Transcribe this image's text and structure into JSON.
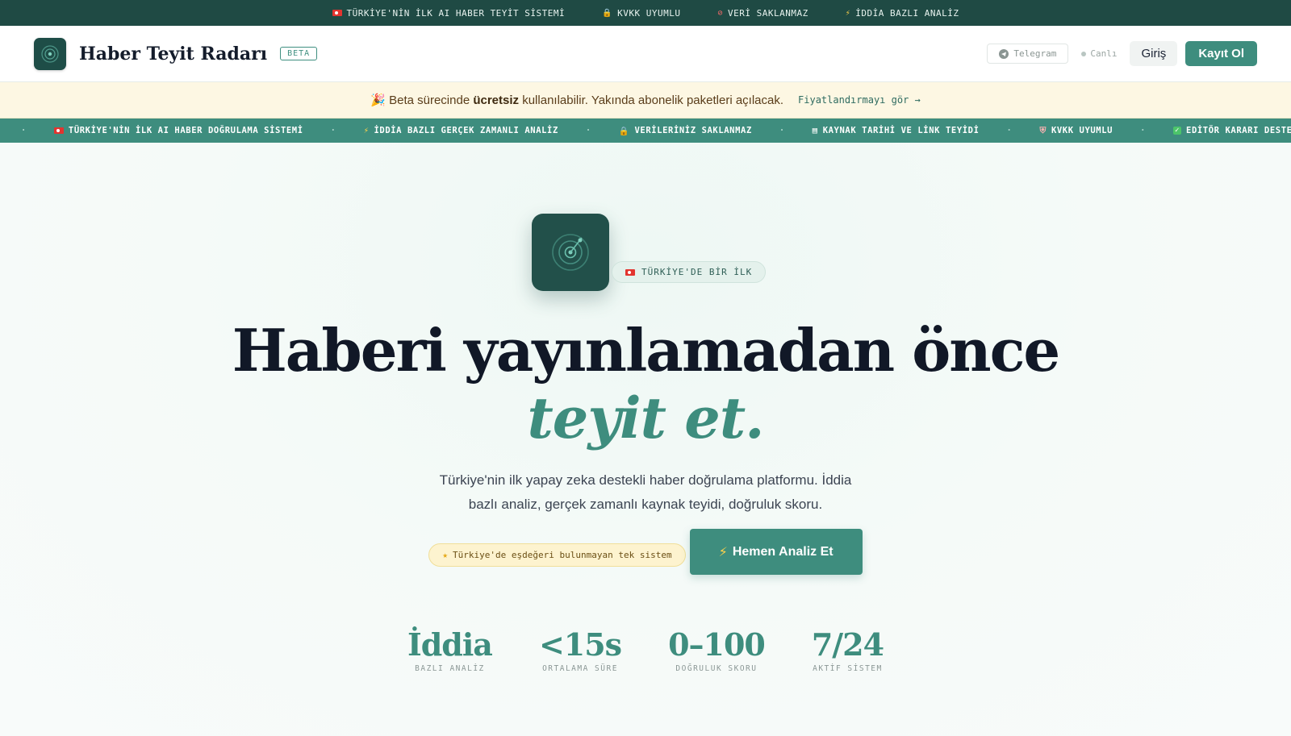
{
  "topstrip": {
    "items": [
      {
        "icon": "flag-icon",
        "label": "TÜRKİYE'NİN İLK AI HABER TEYİT SİSTEMİ"
      },
      {
        "icon": "lock-icon",
        "label": "KVKK UYUMLU"
      },
      {
        "icon": "no-entry-icon",
        "label": "VERİ SAKLANMAZ"
      },
      {
        "icon": "lightning-icon",
        "label": "İDDİA BAZLI ANALİZ"
      }
    ]
  },
  "header": {
    "brand": "Haber Teyit Radarı",
    "beta": "BETA",
    "telegram": "Telegram",
    "live": "Canlı",
    "login": "Giriş",
    "signup": "Kayıt Ol"
  },
  "announce": {
    "emoji": "🎉",
    "prefix": "Beta sürecinde",
    "highlight": "ücretsiz",
    "suffix": "kullanılabilir. Yakında abonelik paketleri açılacak.",
    "link": "Fiyatlandırmayı gör →"
  },
  "ticker": {
    "items": [
      {
        "icon": "flag-icon",
        "label": "TÜRKİYE'NİN İLK AI HABER DOĞRULAMA SİSTEMİ"
      },
      {
        "icon": "lightning-icon",
        "label": "İDDİA BAZLI GERÇEK ZAMANLI ANALİZ"
      },
      {
        "icon": "lock-icon",
        "label": "VERİLERİNİZ SAKLANMAZ"
      },
      {
        "icon": "chart-icon",
        "label": "KAYNAK TARİHİ VE LİNK TEYİDİ"
      },
      {
        "icon": "shield-icon",
        "label": "KVKK UYUMLU"
      },
      {
        "icon": "check-icon",
        "label": "EDİTÖR KARARI DESTE"
      }
    ]
  },
  "hero": {
    "badge": "TÜRKİYE'DE BİR İLK",
    "headline": "Haberi yayınlamadan önce",
    "headline_accent": "teyit et.",
    "sub_line1": "Türkiye'nin ilk yapay zeka destekli haber doğrulama platformu. İddia",
    "sub_line2": "bazlı analiz, gerçek zamanlı kaynak teyidi, doğruluk skoru.",
    "equiv_badge": "Türkiye'de eşdeğeri bulunmayan tek sistem",
    "cta": "Hemen Analiz Et"
  },
  "stats": [
    {
      "value": "İddia",
      "label": "BAZLI ANALİZ"
    },
    {
      "value": "<15s",
      "label": "ORTALAMA SÜRE"
    },
    {
      "value": "0–100",
      "label": "DOĞRULUK SKORU"
    },
    {
      "value": "7/24",
      "label": "AKTİF SİSTEM"
    }
  ],
  "colors": {
    "brand_dark": "#1e4d47",
    "accent": "#3e8d7e",
    "announce_bg": "#fdf7e3"
  }
}
